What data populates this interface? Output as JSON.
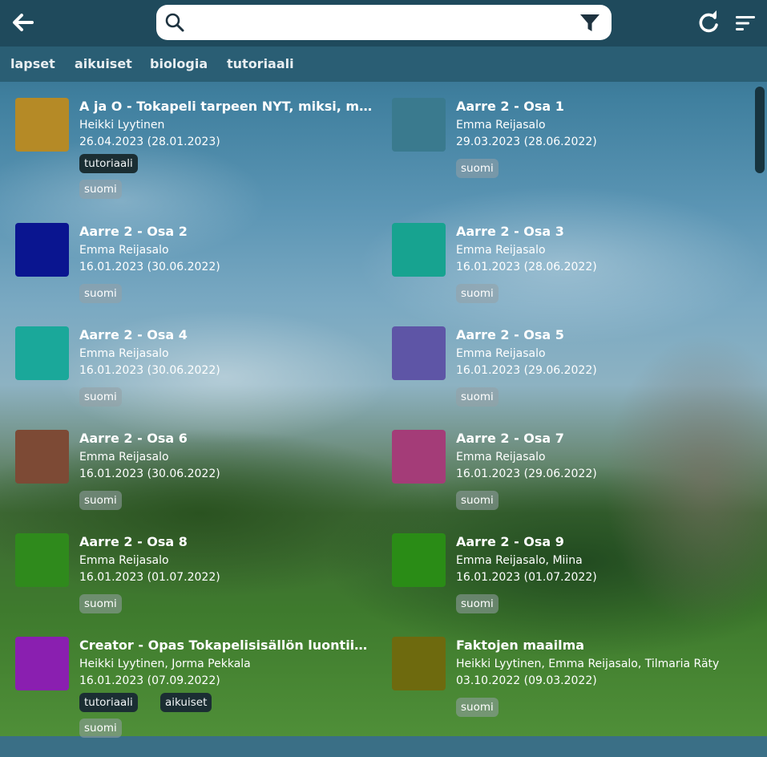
{
  "tags": [
    "lapset",
    "aikuiset",
    "biologia",
    "tutoriaali"
  ],
  "search": {
    "value": "",
    "placeholder": ""
  },
  "icons": {
    "back": "arrow-left-icon",
    "search": "search-icon",
    "filter": "filter-icon",
    "refresh": "refresh-icon",
    "sort": "sort-icon"
  },
  "items": [
    {
      "title": "A ja O - Tokapeli tarpeen NYT, miksi, miten",
      "author": "Heikki Lyytinen",
      "date": "26.04.2023 (28.01.2023)",
      "thumb_color": "#b58a26",
      "category_tags": [
        "tutoriaali"
      ],
      "language_tags": [
        "suomi"
      ]
    },
    {
      "title": "Aarre 2 - Osa 1",
      "author": "Emma Reijasalo",
      "date": "29.03.2023 (28.06.2022)",
      "thumb_color": "#3a7a8e",
      "category_tags": [],
      "language_tags": [
        "suomi"
      ]
    },
    {
      "title": "Aarre 2 - Osa 2",
      "author": "Emma Reijasalo",
      "date": "16.01.2023 (30.06.2022)",
      "thumb_color": "#0a1590",
      "category_tags": [],
      "language_tags": [
        "suomi"
      ]
    },
    {
      "title": "Aarre 2 - Osa 3",
      "author": "Emma Reijasalo",
      "date": "16.01.2023 (28.06.2022)",
      "thumb_color": "#17a390",
      "category_tags": [],
      "language_tags": [
        "suomi"
      ]
    },
    {
      "title": "Aarre 2 - Osa 4",
      "author": "Emma Reijasalo",
      "date": "16.01.2023 (30.06.2022)",
      "thumb_color": "#1aa89a",
      "category_tags": [],
      "language_tags": [
        "suomi"
      ]
    },
    {
      "title": "Aarre 2 - Osa 5",
      "author": "Emma Reijasalo",
      "date": "16.01.2023 (29.06.2022)",
      "thumb_color": "#5e55a6",
      "category_tags": [],
      "language_tags": [
        "suomi"
      ]
    },
    {
      "title": "Aarre 2 - Osa 6",
      "author": "Emma Reijasalo",
      "date": "16.01.2023 (30.06.2022)",
      "thumb_color": "#7d4a35",
      "category_tags": [],
      "language_tags": [
        "suomi"
      ]
    },
    {
      "title": "Aarre 2 - Osa 7",
      "author": "Emma Reijasalo",
      "date": "16.01.2023 (29.06.2022)",
      "thumb_color": "#a43c78",
      "category_tags": [],
      "language_tags": [
        "suomi"
      ]
    },
    {
      "title": "Aarre 2 - Osa 8",
      "author": "Emma Reijasalo",
      "date": "16.01.2023 (01.07.2022)",
      "thumb_color": "#2f8a1c",
      "category_tags": [],
      "language_tags": [
        "suomi"
      ]
    },
    {
      "title": "Aarre 2 - Osa 9",
      "author": "Emma Reijasalo, Miina",
      "date": "16.01.2023 (01.07.2022)",
      "thumb_color": "#2a8c16",
      "category_tags": [],
      "language_tags": [
        "suomi"
      ]
    },
    {
      "title": "Creator - Opas Tokapelisisällön luontiin ja julkaisuun",
      "author": "Heikki Lyytinen, Jorma Pekkala",
      "date": "16.01.2023 (07.09.2022)",
      "thumb_color": "#8a1fb0",
      "category_tags": [
        "tutoriaali",
        "aikuiset"
      ],
      "language_tags": [
        "suomi"
      ]
    },
    {
      "title": "Faktojen maailma",
      "author": "Heikki Lyytinen, Emma Reijasalo, Tilmaria Räty",
      "date": "03.10.2022 (09.03.2022)",
      "thumb_color": "#6e6a0e",
      "category_tags": [],
      "language_tags": [
        "suomi"
      ]
    }
  ]
}
